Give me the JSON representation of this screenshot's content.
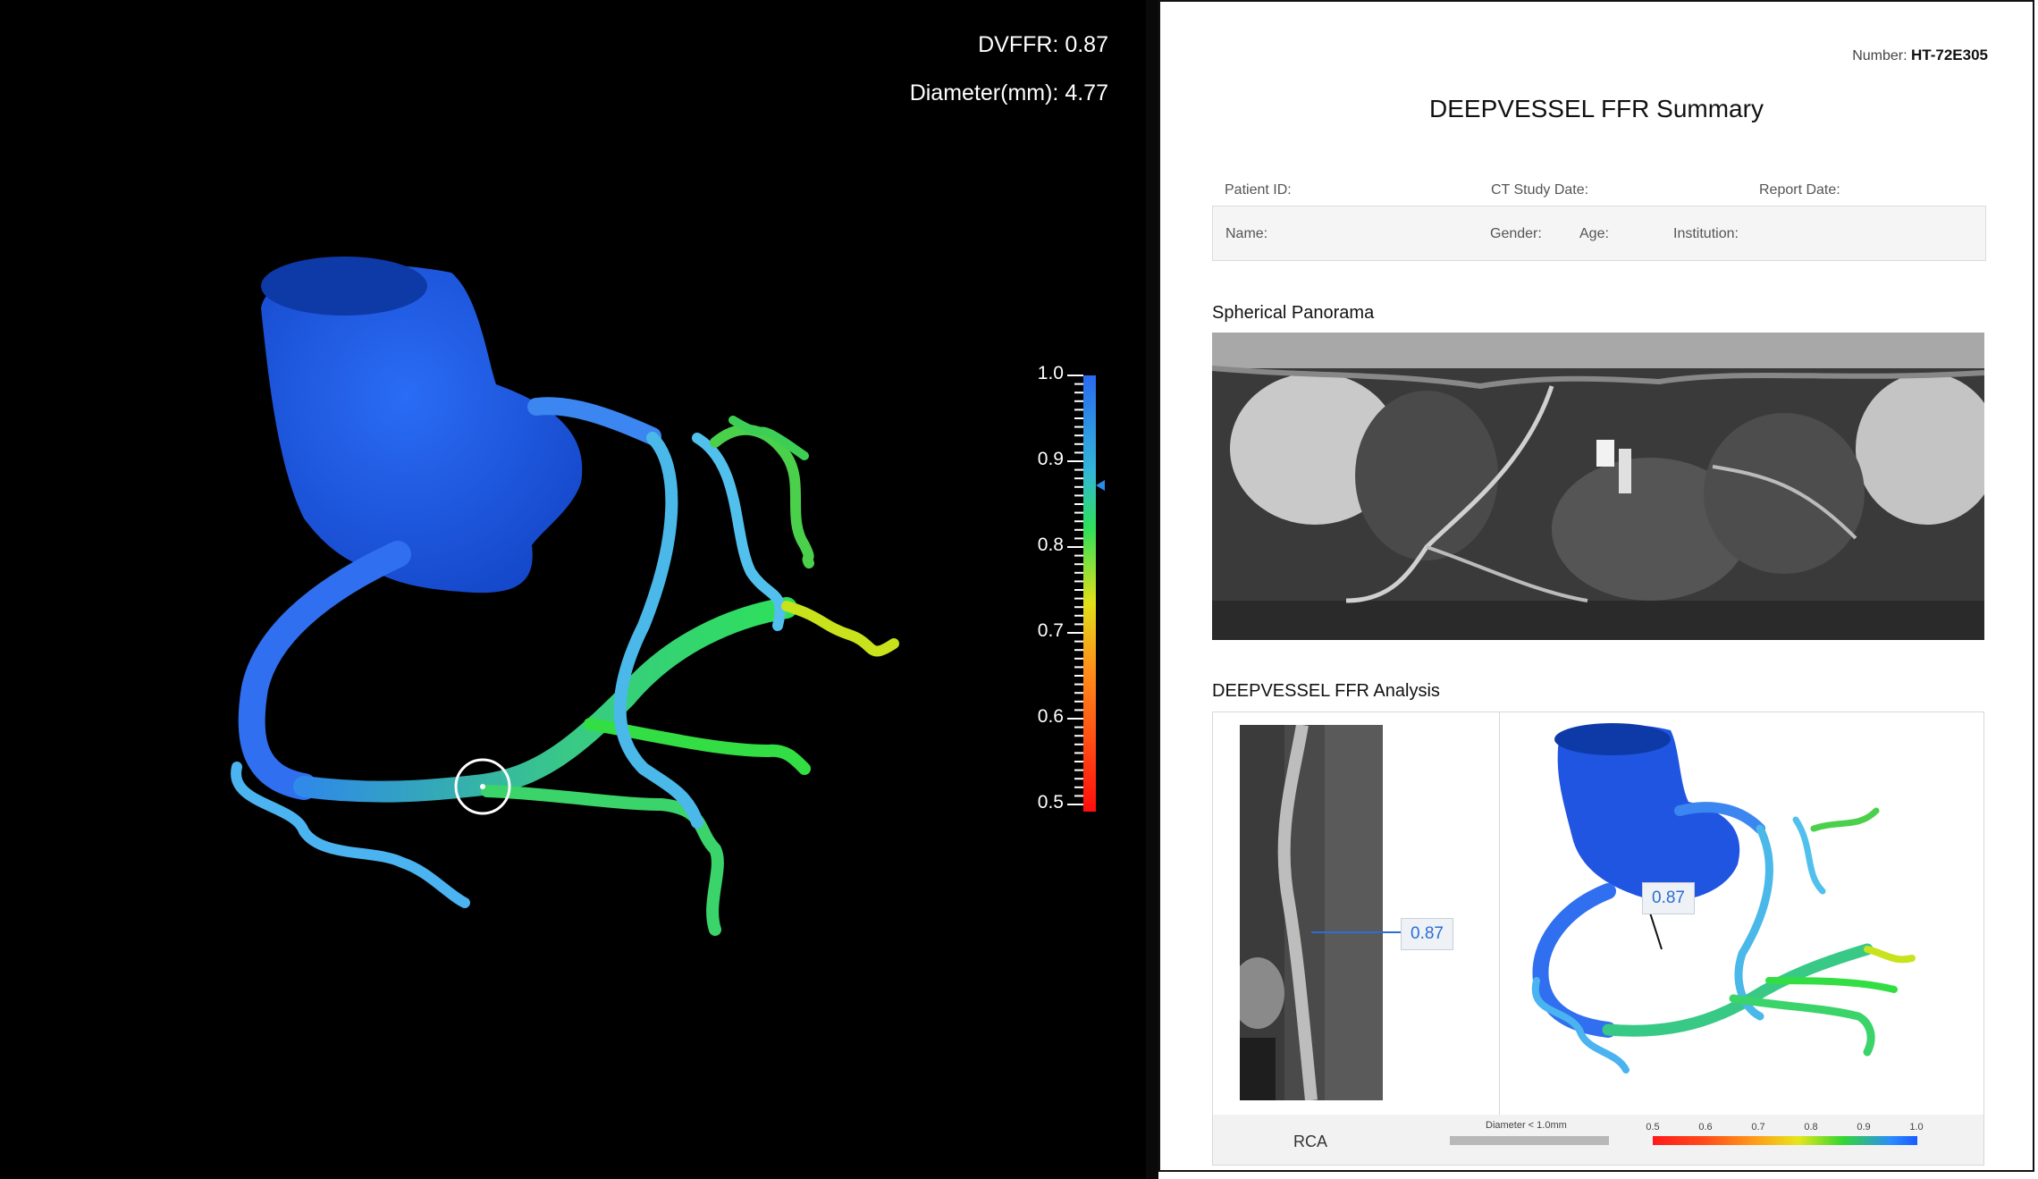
{
  "viewer": {
    "dvffr_label": "DVFFR:",
    "dvffr_value": "0.87",
    "diameter_label": "Diameter(mm):",
    "diameter_value": "4.77",
    "colorbar_ticks": [
      "1.0",
      "0.9",
      "0.8",
      "0.7",
      "0.6",
      "0.5"
    ],
    "colorbar_marker_value": 0.87,
    "colors": {
      "background": "#000000",
      "aorta": "#1f5fe8",
      "vessel_high": "#3d8ff5",
      "vessel_mid": "#2ee05a",
      "vessel_low": "#e8e81c",
      "marker": "#2a8ce8"
    }
  },
  "report": {
    "number_label": "Number:",
    "number_value": "HT-72E305",
    "title": "DEEPVESSEL FFR Summary",
    "fields_row1": [
      "Patient ID:",
      "CT Study Date:",
      "Report Date:"
    ],
    "fields_row2": [
      "Name:",
      "Gender:",
      "Age:",
      "Institution:"
    ],
    "panorama_title": "Spherical Panorama",
    "analysis_title": "DEEPVESSEL FFR Analysis",
    "cpr_callout": "0.87",
    "model_callout": "0.87",
    "vessel_name": "RCA",
    "diameter_legend": "Diameter < 1.0mm",
    "scale_ticks": [
      "0.5",
      "0.6",
      "0.7",
      "0.8",
      "0.9",
      "1.0"
    ]
  }
}
